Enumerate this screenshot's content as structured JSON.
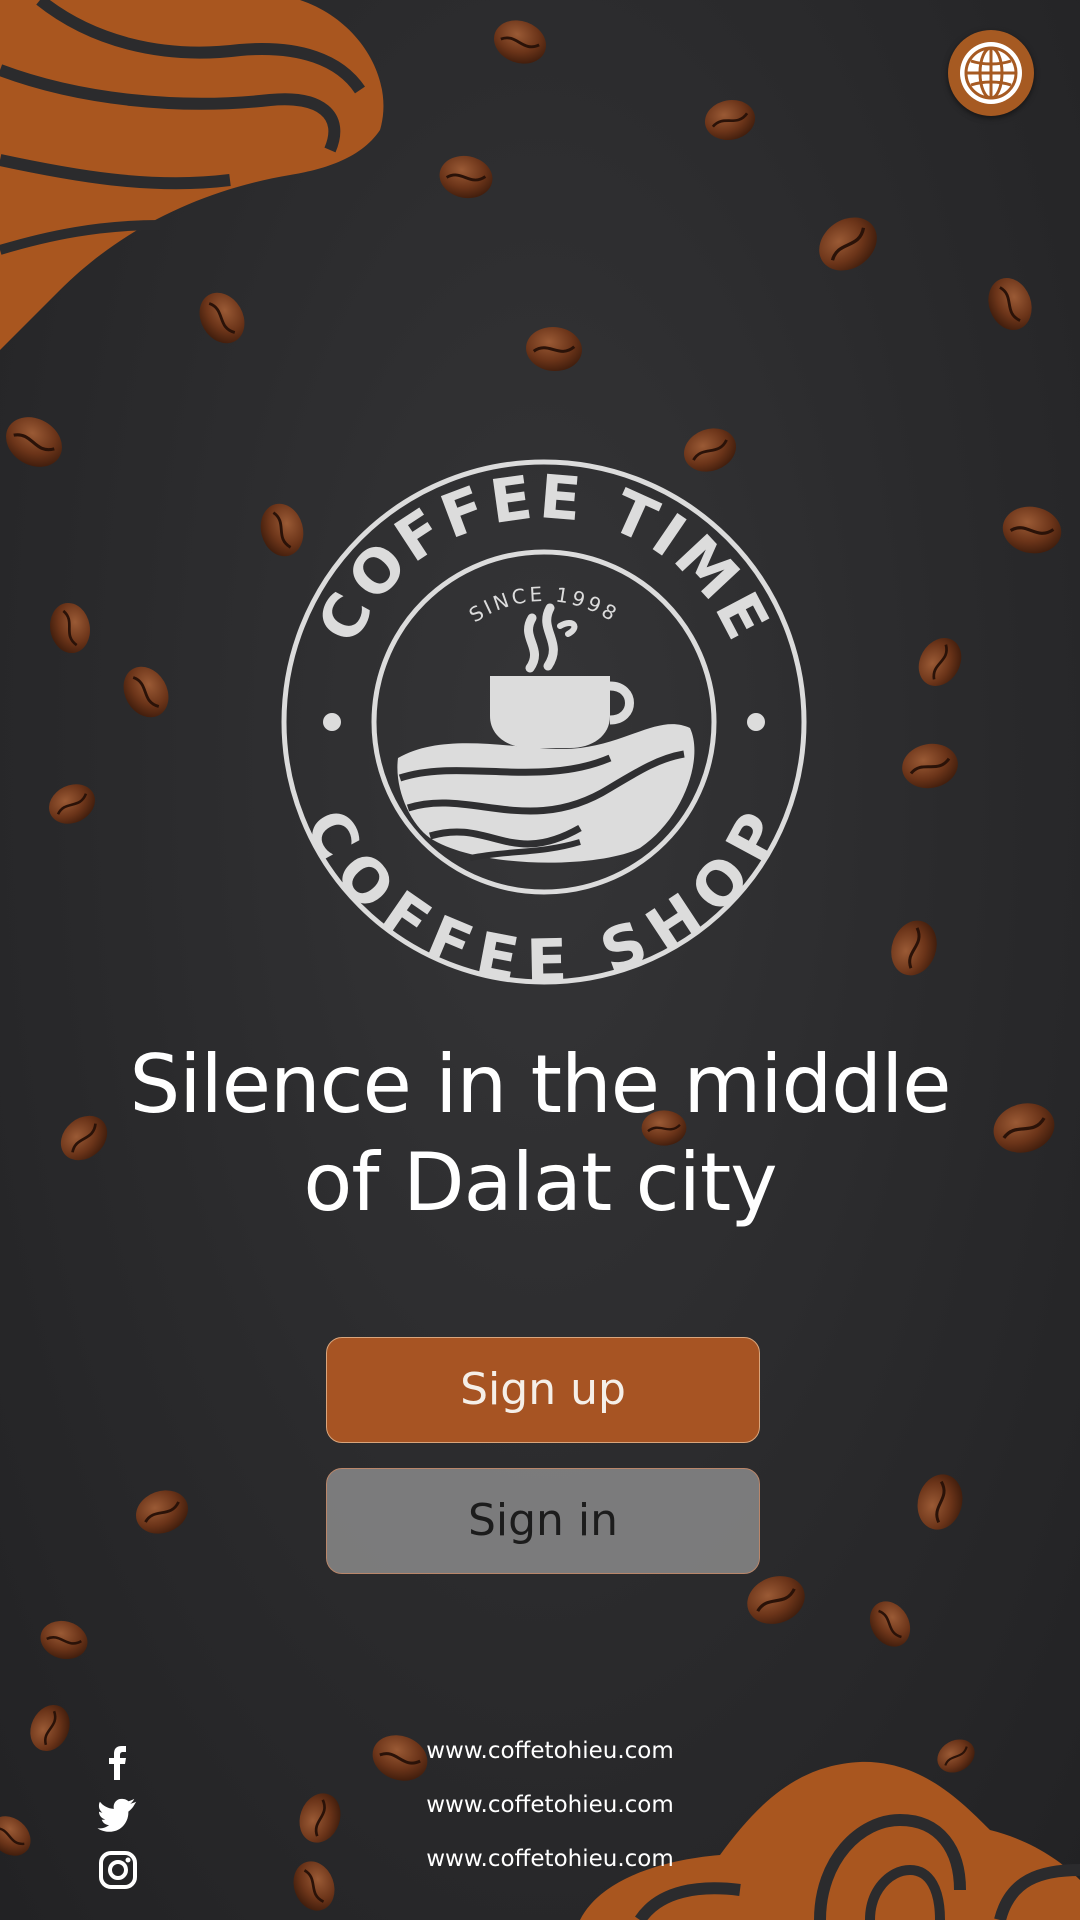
{
  "colors": {
    "accent": "#a75423",
    "background": "#2b2b2d",
    "logo": "#dcdcdc",
    "text": "#ffffff"
  },
  "header": {
    "language_icon": "globe-icon"
  },
  "logo": {
    "top_text": "COFFEE TIME",
    "bottom_text": "COFFEE SHOP",
    "since_text": "SINCE 1998"
  },
  "headline": {
    "line1": "Silence in the middle",
    "line2": "of Dalat city"
  },
  "actions": {
    "signup_label": "Sign up",
    "signin_label": "Sign in"
  },
  "social": {
    "icons": [
      "facebook-icon",
      "twitter-icon",
      "instagram-icon"
    ]
  },
  "footer": {
    "links": [
      "www.coffetohieu.com",
      "www.coffetohieu.com",
      "www.coffetohieu.com"
    ]
  }
}
